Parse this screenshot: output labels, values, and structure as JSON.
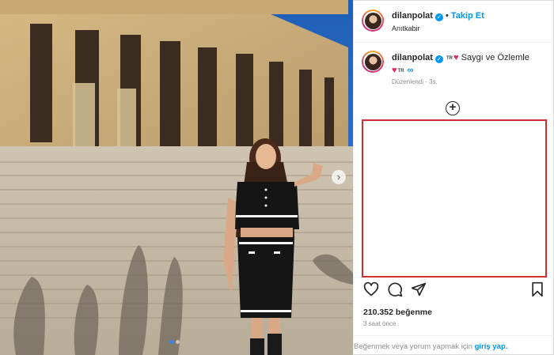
{
  "post": {
    "username": "dilanpolat",
    "follow_label": "Takip Et",
    "separator": "•",
    "location": "Anıtkabir"
  },
  "caption": {
    "username": "dilanpolat",
    "flag_code": "TR",
    "text": "Saygı ve Özlemle",
    "flag_code_2": "TR",
    "edited": "Düzenlendi · 3s."
  },
  "stats": {
    "likes": "210.352 beğenme",
    "time": "3 saat önce"
  },
  "footer": {
    "text": "Beğenmek veya yorum yapmak için",
    "login_label": "giriş yap."
  },
  "carousel": {
    "dots": 2,
    "active_index": 0
  },
  "icons": {
    "verified": "verified-badge-icon",
    "plus": "add-circle-icon",
    "like": "heart-icon",
    "comment": "comment-icon",
    "share": "send-icon",
    "save": "bookmark-icon",
    "next": "chevron-right-icon"
  },
  "colors": {
    "link_blue": "#0095f6",
    "highlight_border": "#d32f2f",
    "heart_red": "#e0245e"
  }
}
